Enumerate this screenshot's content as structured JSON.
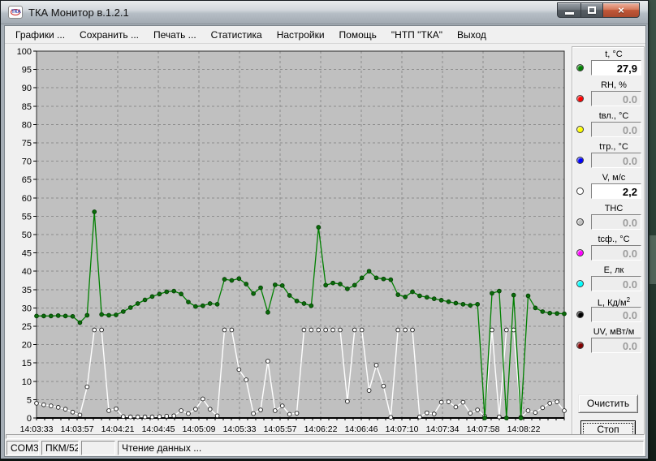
{
  "window": {
    "title": "ТКА Монитор в.1.2.1",
    "icons": {
      "app": "tka-logo",
      "minimize": "minimize-dash",
      "maximize": "maximize-box",
      "close": "×"
    }
  },
  "menu": {
    "items": [
      "Графики ...",
      "Сохранить ...",
      "Печать ...",
      "Статистика",
      "Настройки",
      "Помощь",
      "\"НТП \"ТКА\"",
      "Выход"
    ]
  },
  "chart_data": {
    "type": "line",
    "title": "",
    "xlabel": "",
    "ylabel": "",
    "ylim": [
      0,
      100
    ],
    "ytick_step": 5,
    "grid": "dashed",
    "plot_bg": "#c0c0c0",
    "legend_position": "right-panel",
    "x_labels": [
      "14:03:33",
      "14:03:57",
      "14:04:21",
      "14:04:45",
      "14:05:09",
      "14:05:33",
      "14:05:57",
      "14:06:22",
      "14:06:46",
      "14:07:10",
      "14:07:34",
      "14:07:58",
      "14:08:22"
    ],
    "series": [
      {
        "name": "t, °C",
        "color": "#008000",
        "marker": "filled-circle",
        "values": [
          27.8,
          27.8,
          27.8,
          27.9,
          27.8,
          27.7,
          26.0,
          28.0,
          56.2,
          28.2,
          28.0,
          28.1,
          29.0,
          30.1,
          31.2,
          32.2,
          33.1,
          33.8,
          34.4,
          34.6,
          33.8,
          31.6,
          30.4,
          30.6,
          31.2,
          31.0,
          37.8,
          37.5,
          38.0,
          36.5,
          33.9,
          35.5,
          28.8,
          36.3,
          36.1,
          33.4,
          31.9,
          31.2,
          30.6,
          52.0,
          36.2,
          36.8,
          36.5,
          35.2,
          36.2,
          38.2,
          40.0,
          38.2,
          37.9,
          37.7,
          33.6,
          33.0,
          34.4,
          33.3,
          32.9,
          32.5,
          32.1,
          31.7,
          31.3,
          31.0,
          30.7,
          31.0,
          0.0,
          34.0,
          34.6,
          0.0,
          33.5,
          0.0,
          33.3,
          30.0,
          29.0,
          28.6,
          28.5,
          28.4
        ]
      },
      {
        "name": "V, м/с",
        "color": "#ffffff",
        "marker": "open-circle",
        "values": [
          4.0,
          3.6,
          3.3,
          2.9,
          2.4,
          1.6,
          0.8,
          8.5,
          24.0,
          24.0,
          2.0,
          2.5,
          0.4,
          0.3,
          0.3,
          0.3,
          0.3,
          0.4,
          0.5,
          0.6,
          2.0,
          1.2,
          2.4,
          5.2,
          2.4,
          0.6,
          24.0,
          24.0,
          13.2,
          10.4,
          1.2,
          2.2,
          15.5,
          2.0,
          3.3,
          1.0,
          1.3,
          24.0,
          24.0,
          24.0,
          24.0,
          24.0,
          24.0,
          4.5,
          24.0,
          24.0,
          7.5,
          14.4,
          8.7,
          0.2,
          24.0,
          24.0,
          24.0,
          0.3,
          1.4,
          1.1,
          4.3,
          4.4,
          3.0,
          4.3,
          1.3,
          2.2,
          0.5,
          24.0,
          0.3,
          24.0,
          24.0,
          0.2,
          2.0,
          1.5,
          2.8,
          4.0,
          4.4,
          2.0
        ]
      }
    ]
  },
  "panel": {
    "sensors": [
      {
        "label": "t, °C",
        "color": "#008000",
        "value": "27,9",
        "active": true
      },
      {
        "label": "RH, %",
        "color": "#ff0000",
        "value": "0.0",
        "active": false
      },
      {
        "label": "tвл., °C",
        "color": "#ffff00",
        "value": "0.0",
        "active": false
      },
      {
        "label": "tтр., °C",
        "color": "#0000ff",
        "value": "0.0",
        "active": false
      },
      {
        "label": "V, м/с",
        "color": "#ffffff",
        "value": "2,2",
        "active": true
      },
      {
        "label": "ТНС",
        "color": "#c0c0c0",
        "value": "0.0",
        "active": false
      },
      {
        "label": "tсф., °C",
        "color": "#ff00ff",
        "value": "0.0",
        "active": false
      },
      {
        "label": "E, лк",
        "color": "#00ffff",
        "value": "0.0",
        "active": false
      },
      {
        "label": "L, Кд/м",
        "sup": "2",
        "color": "#000000",
        "value": "0.0",
        "active": false
      },
      {
        "label": "UV, мВт/м",
        "color": "#800000",
        "value": "0.0",
        "active": false
      }
    ],
    "clear_label": "Очистить",
    "stop_label": "Стоп"
  },
  "status": {
    "cells": [
      "COM3",
      "ПКМ/52",
      "",
      "Чтение данных ..."
    ]
  }
}
